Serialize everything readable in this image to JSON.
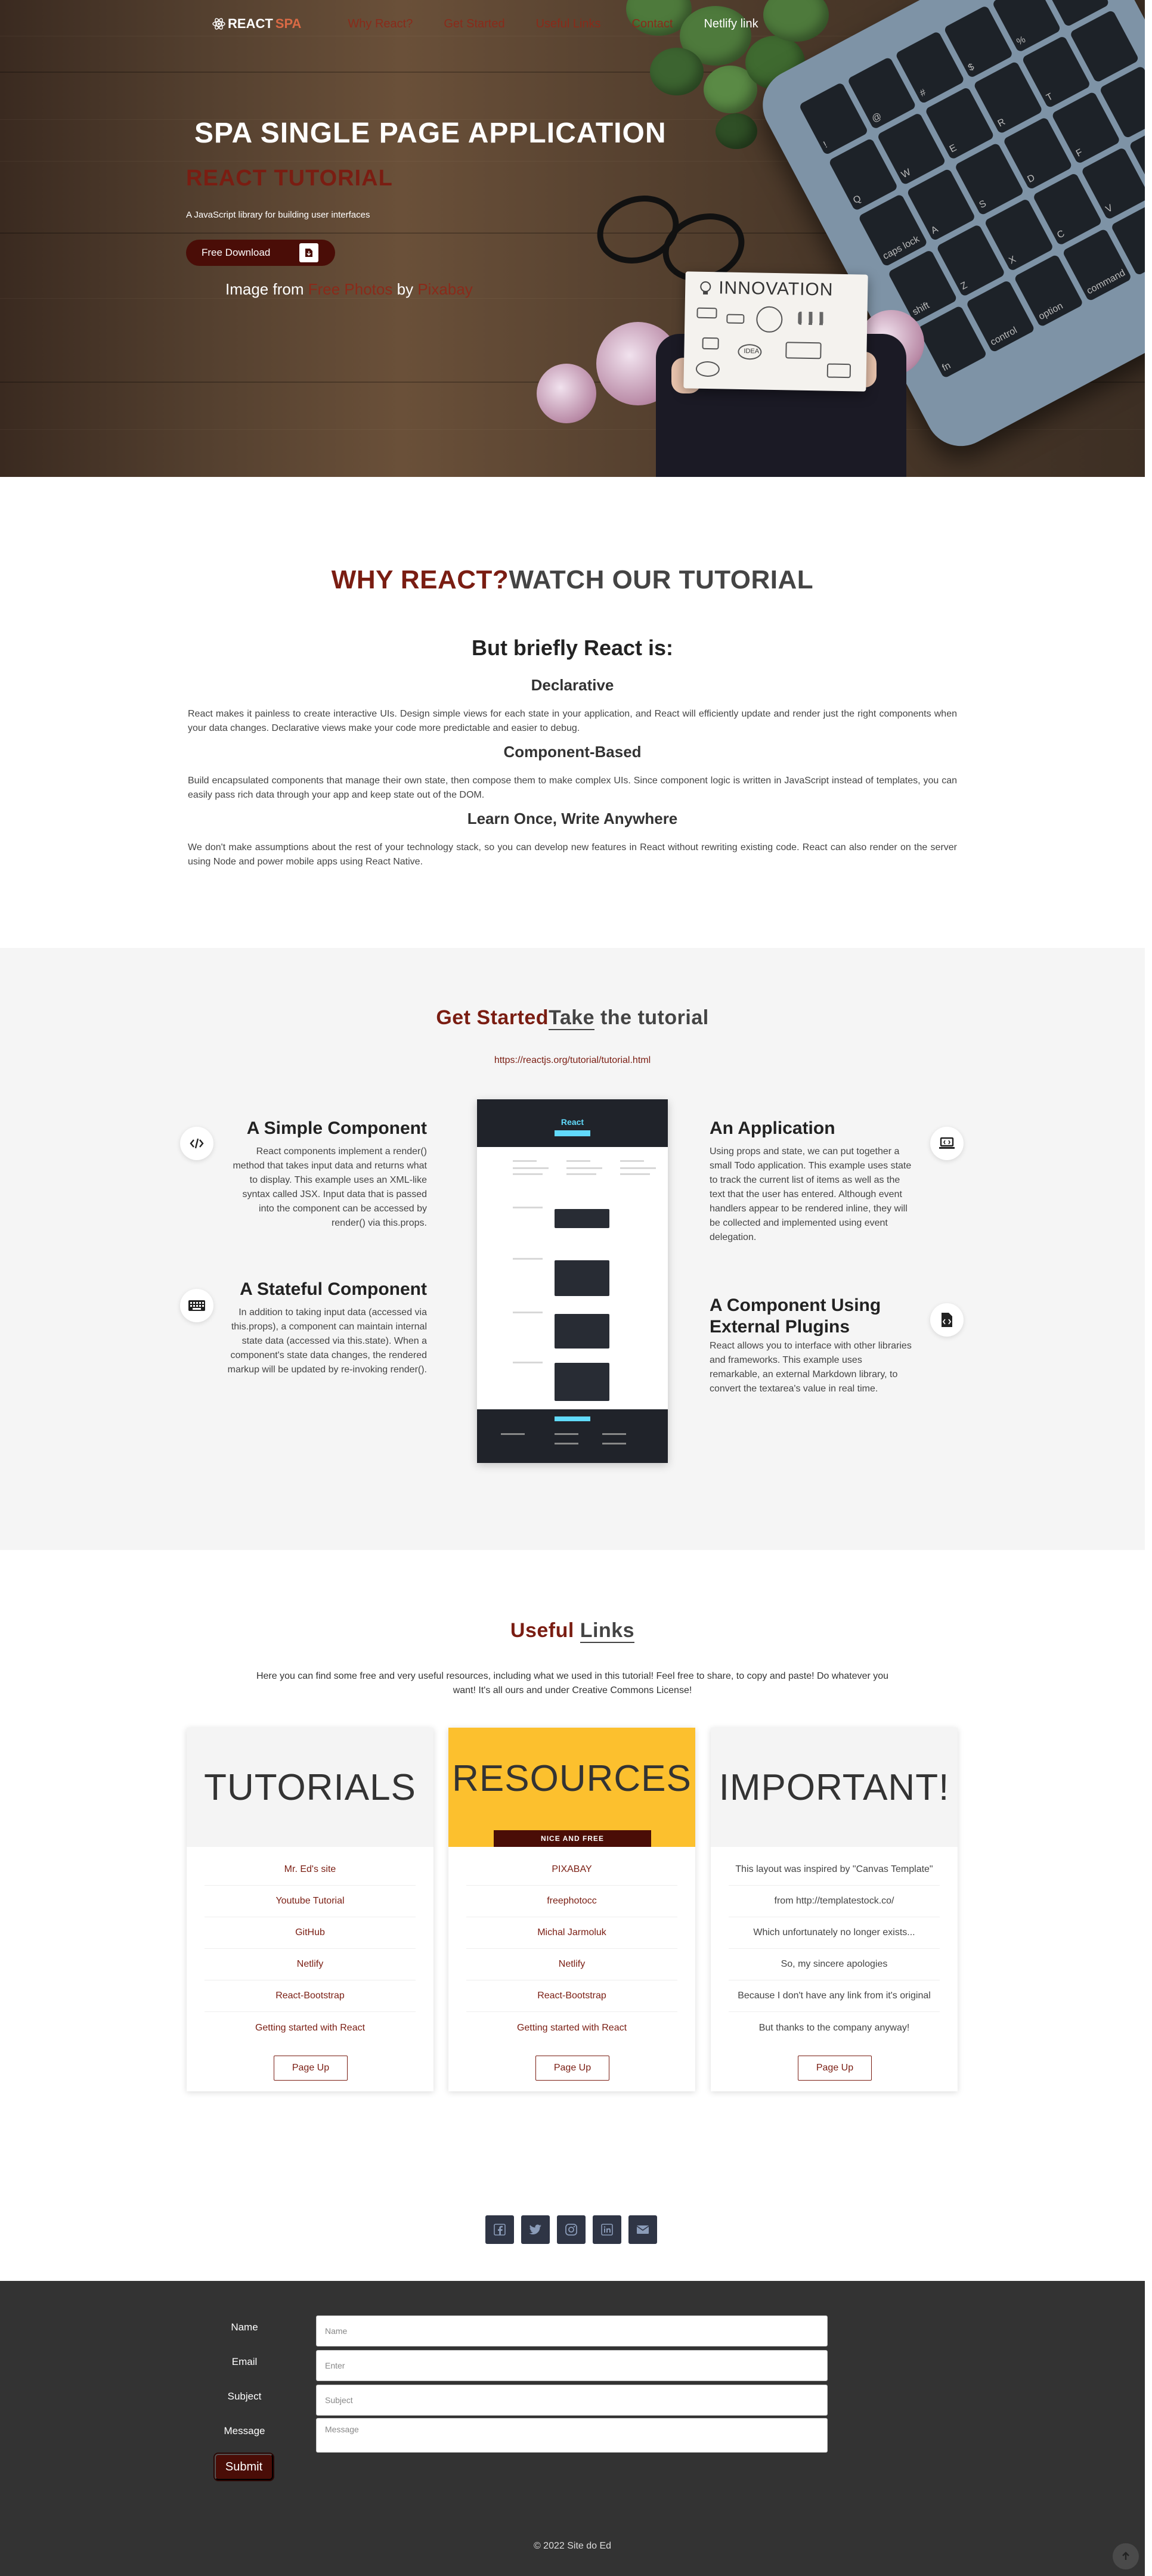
{
  "nav": {
    "logo_react": "REACT",
    "logo_spa": "SPA",
    "links": [
      "Why React?",
      "Get Started",
      "Useful Links",
      "Contact",
      "Netlify link"
    ]
  },
  "hero": {
    "title": "SPA SINGLE PAGE APPLICATION",
    "subtitle": "REACT TUTORIAL",
    "lead": "A JavaScript library for building user interfaces",
    "download_label": "Free Download",
    "credit_prefix": "Image from",
    "credit_link1": "Free Photos",
    "credit_by": "by",
    "credit_link2": "Pixabay",
    "paper_title": "INNOVATION",
    "paper_idea": "IDEA"
  },
  "why": {
    "title_accent": "WHY REACT?",
    "title_rest": "WATCH OUR TUTORIAL",
    "briefly": "But briefly React is:",
    "features": [
      {
        "title": "Declarative",
        "text": "React makes it painless to create interactive UIs. Design simple views for each state in your application, and React will efficiently update and render just the right components when your data changes. Declarative views make your code more predictable and easier to debug."
      },
      {
        "title": "Component-Based",
        "text": "Build encapsulated components that manage their own state, then compose them to make complex UIs. Since component logic is written in JavaScript instead of templates, you can easily pass rich data through your app and keep state out of the DOM."
      },
      {
        "title": "Learn Once, Write Anywhere",
        "text": "We don't make assumptions about the rest of your technology stack, so you can develop new features in React without rewriting existing code. React can also render on the server using Node and power mobile apps using React Native."
      }
    ]
  },
  "get_started": {
    "title_accent": "Get Started",
    "title_underlined": "Take",
    "title_rest": " the tutorial",
    "url": "https://reactjs.org/tutorial/tutorial.html",
    "items": [
      {
        "title": "A Simple Component",
        "text": "React components implement a render() method that takes input data and returns what to display. This example uses an XML-like syntax called JSX. Input data that is passed into the component can be accessed by render() via this.props.",
        "icon": "code-icon"
      },
      {
        "title": "A Stateful Component",
        "text": "In addition to taking input data (accessed via this.props), a component can maintain internal state data (accessed via this.state). When a component's state data changes, the rendered markup will be updated by re-invoking render().",
        "icon": "keyboard-icon"
      },
      {
        "title": "An Application",
        "text": "Using props and state, we can put together a small Todo application. This example uses state to track the current list of items as well as the text that the user has entered. Although event handlers appear to be rendered inline, they will be collected and implemented using event delegation.",
        "icon": "laptop-code-icon"
      },
      {
        "title": "A Component Using External Plugins",
        "text": "React allows you to interface with other libraries and frameworks. This example uses remarkable, an external Markdown library, to convert the textarea's value in real time.",
        "icon": "file-code-icon"
      }
    ],
    "screenshot_brand": "React"
  },
  "useful": {
    "title_accent": "Useful",
    "title_rest": "Links",
    "desc": "Here you can find some free and very useful resources, including what we used in this tutorial! Feel free to share, to copy and paste! Do whatever you want! It's all ours and under Creative Commons License!",
    "cards": [
      {
        "title": "TUTORIALS",
        "items": [
          "Mr. Ed's site",
          "Youtube Tutorial",
          "GitHub",
          "Netlify",
          "React-Bootstrap",
          "Getting started with React"
        ],
        "button": "Page Up"
      },
      {
        "title": "RESOURCES",
        "tag": "NICE AND FREE",
        "items": [
          "PIXABAY",
          "freephotocc",
          "Michal Jarmoluk",
          "Netlify",
          "React-Bootstrap",
          "Getting started with React"
        ],
        "button": "Page Up"
      },
      {
        "title": "IMPORTANT!",
        "items": [
          "This layout was inspired by \"Canvas Template\"",
          "from http://templatestock.co/",
          "Which unfortunately no longer exists...",
          "So, my sincere apologies",
          "Because I don't have any link from it's original",
          "But thanks to the company anyway!"
        ],
        "button": "Page Up"
      }
    ]
  },
  "social": [
    "facebook-icon",
    "twitter-icon",
    "instagram-icon",
    "linkedin-icon",
    "email-icon"
  ],
  "contact": {
    "labels": [
      "Name",
      "Email",
      "Subject",
      "Message"
    ],
    "placeholders": [
      "Name",
      "Enter",
      "Subject",
      "Message"
    ],
    "submit": "Submit"
  },
  "footer": {
    "copyright": "© 2022 Site do Ed"
  },
  "colors": {
    "accent": "#7a1d12",
    "button_dark": "#4a0d07",
    "highlight": "#fcc02e",
    "footer_bg": "#333333"
  }
}
